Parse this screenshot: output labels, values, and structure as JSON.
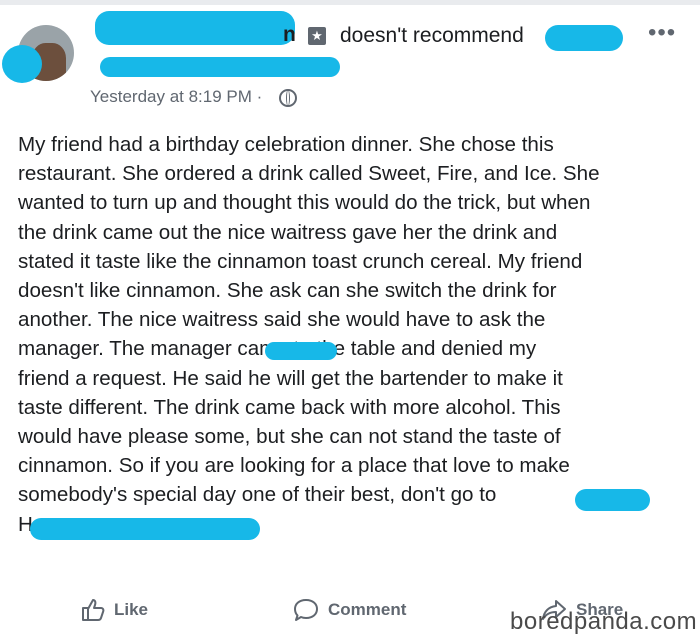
{
  "post": {
    "author_suffix": "n",
    "action_text": "doesn't recommend",
    "timestamp": "Yesterday at 8:19 PM ·",
    "body_lines": [
      "My friend had a birthday celebration dinner. She chose this",
      "restaurant. She ordered a drink called Sweet, Fire, and Ice.  She",
      "wanted to turn up and thought this would do the trick, but when",
      "the drink came out the nice waitress gave her the drink and",
      "stated it taste like the cinnamon toast crunch cereal. My friend",
      "doesn't like cinnamon. She ask can she switch the drink for",
      "another. The nice waitress said she would have to ask the",
      "manager. The manager          came to the table and denied my",
      "friend a request. He said he will get the bartender to make it",
      "taste different. The drink came back with more alcohol. This",
      "would have please some, but she can not stand the taste of",
      "cinnamon. So if you are looking for a place that love to make",
      "somebody's special day one of their best, don't go to",
      "H"
    ]
  },
  "actions": {
    "like_label": "Like",
    "comment_label": "Comment",
    "share_label": "Share"
  },
  "watermark": "boredpanda.com",
  "icons": {
    "recommend": "recommend-icon",
    "more": "more-options-icon",
    "audience": "globe-icon",
    "like": "thumbs-up-icon",
    "comment": "comment-bubble-icon",
    "share": "share-arrow-icon"
  },
  "colors": {
    "redaction": "#17b8e8",
    "secondary_text": "#606770"
  }
}
